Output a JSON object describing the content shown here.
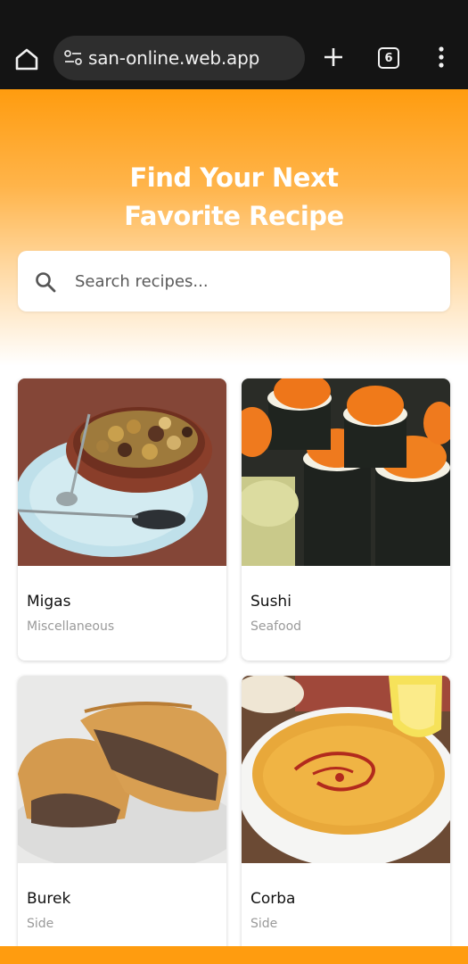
{
  "browser": {
    "url": "san-online.web.app",
    "tab_count": "6"
  },
  "hero": {
    "title_line1": "Find Your Next",
    "title_line2": "Favorite Recipe",
    "search_placeholder": "Search recipes..."
  },
  "recipes": [
    {
      "name": "Migas",
      "category": "Miscellaneous"
    },
    {
      "name": "Sushi",
      "category": "Seafood"
    },
    {
      "name": "Burek",
      "category": "Side"
    },
    {
      "name": "Corba",
      "category": "Side"
    }
  ],
  "colors": {
    "accent": "#ff9c0f",
    "browser_bg": "#141414",
    "url_pill": "#2e2e2e"
  }
}
